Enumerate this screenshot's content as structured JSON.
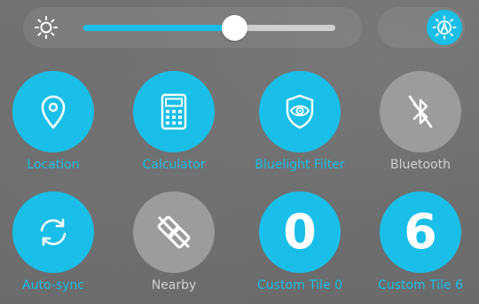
{
  "brightness": {
    "level": 0.6,
    "icon": "sun-icon",
    "auto_icon": "auto-brightness-icon"
  },
  "colors": {
    "accent": "#19bfe8",
    "tile_off": "#9c9c9c",
    "label_off": "#d0d0d0",
    "background": "#6f6f6f"
  },
  "tiles": [
    {
      "label": "Location",
      "icon": "location-pin-icon",
      "active": true
    },
    {
      "label": "Calculator",
      "icon": "calculator-icon",
      "active": true
    },
    {
      "label": "Bluelight Filter",
      "icon": "eye-shield-icon",
      "active": true
    },
    {
      "label": "Bluetooth",
      "icon": "bluetooth-off-icon",
      "active": false
    },
    {
      "label": "Auto-sync",
      "icon": "sync-icon",
      "active": true
    },
    {
      "label": "Nearby",
      "icon": "nearby-off-icon",
      "active": false
    },
    {
      "label": "Custom Tile 0",
      "value": "0",
      "active": true
    },
    {
      "label": "Custom Tile 6",
      "value": "6",
      "active": true
    }
  ]
}
